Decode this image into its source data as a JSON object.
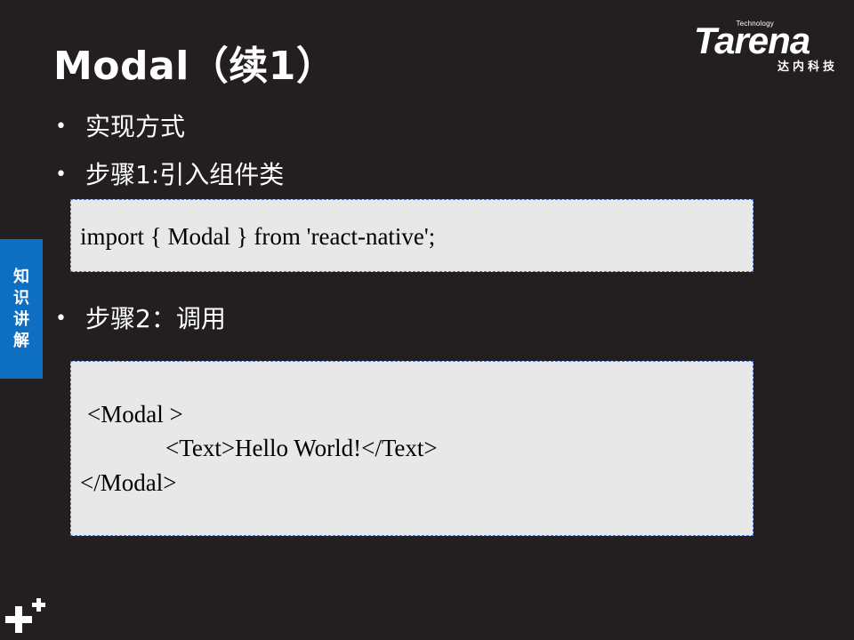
{
  "slide": {
    "title": "Modal（续1）",
    "bullets": [
      "实现方式",
      "步骤1:引入组件类",
      "步骤2：调用"
    ],
    "bullet_marker": "•",
    "code_block_1": {
      "lines": [
        "import { Modal } from 'react-native';"
      ]
    },
    "code_block_2": {
      "lines": [
        "<Modal >",
        "<Text>Hello World!</Text>",
        "</Modal>"
      ]
    }
  },
  "logo": {
    "word": "Tarena",
    "tagline": "Technology",
    "cn_name": "达内科技"
  },
  "side_tab": {
    "chars": [
      "知",
      "识",
      "讲",
      "解"
    ]
  },
  "colors": {
    "background": "#231f20",
    "side_tab": "#0d6ec2",
    "code_box_bg": "#e8e8e8",
    "code_box_border": "#4a6fc0"
  },
  "icons": {
    "bottom_left": "plus-logo-icon"
  }
}
